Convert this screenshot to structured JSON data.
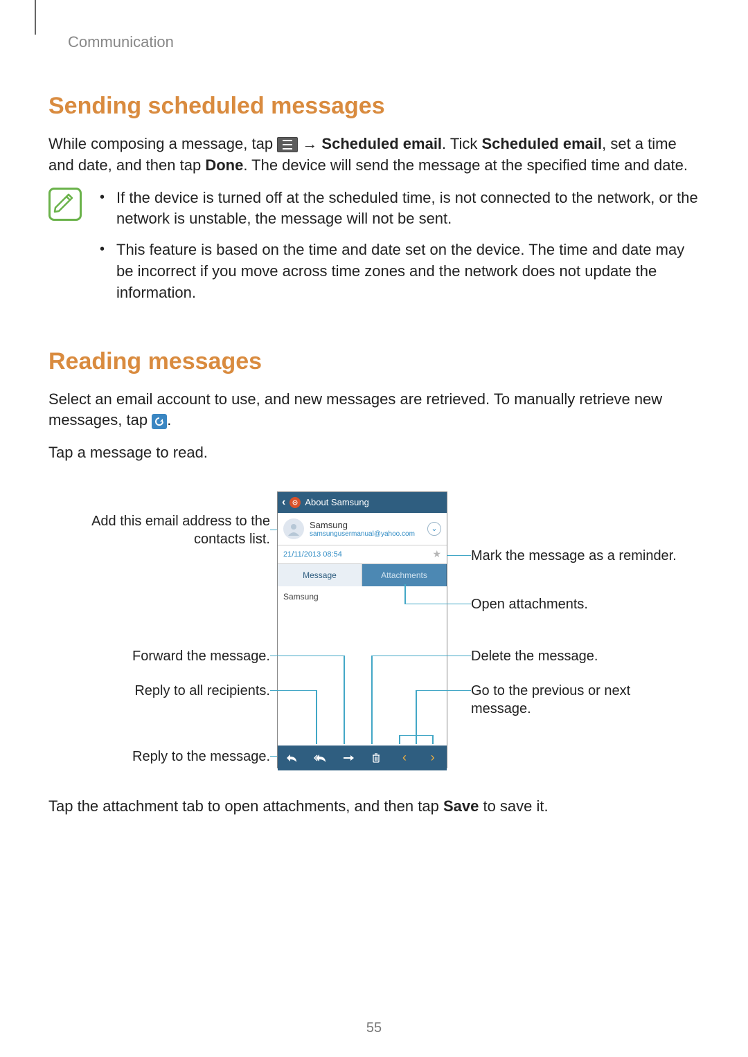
{
  "chapter": "Communication",
  "section1": {
    "heading": "Sending scheduled messages",
    "para_p1": "While composing a message, tap ",
    "arrow": "→",
    "para_b1": "Scheduled email",
    "para_mid": ". Tick ",
    "para_b2": "Scheduled email",
    "para_p2": ", set a time and date, and then tap ",
    "para_b3": "Done",
    "para_p3": ". The device will send the message at the specified time and date.",
    "notes": [
      "If the device is turned off at the scheduled time, is not connected to the network, or the network is unstable, the message will not be sent.",
      "This feature is based on the time and date set on the device. The time and date may be incorrect if you move across time zones and the network does not update the information."
    ]
  },
  "section2": {
    "heading": "Reading messages",
    "para1a": "Select an email account to use, and new messages are retrieved. To manually retrieve new messages, tap ",
    "para1b": ".",
    "para2": "Tap a message to read.",
    "para3a": "Tap the attachment tab to open attachments, and then tap ",
    "para3b": "Save",
    "para3c": " to save it."
  },
  "screenshot": {
    "title": "About Samsung",
    "sender_name": "Samsung",
    "sender_email": "samsungusermanual@yahoo.com",
    "datetime": "21/11/2013 08:54",
    "tab_message": "Message",
    "tab_attachments": "Attachments",
    "body_text": "Samsung"
  },
  "callouts": {
    "left_contact": "Add this email address to the contacts list.",
    "left_forward": "Forward the message.",
    "left_replyall": "Reply to all recipients.",
    "left_reply": "Reply to the message.",
    "right_star": "Mark the message as a reminder.",
    "right_attach": "Open attachments.",
    "right_delete": "Delete the message.",
    "right_nav": "Go to the previous or next message."
  },
  "page_number": "55"
}
